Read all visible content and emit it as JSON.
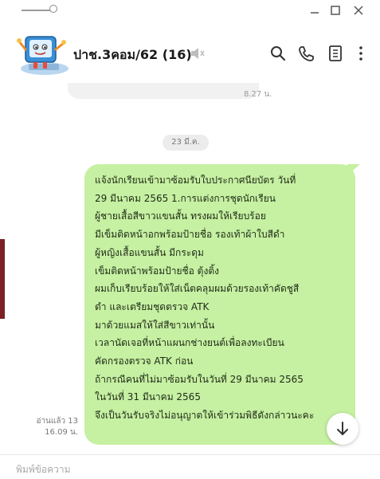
{
  "window": {
    "controls": [
      "minimize-icon",
      "maximize-icon",
      "close-icon"
    ]
  },
  "header": {
    "chat_title": "ปาช.3คอม/62 (16)",
    "icons": [
      "mute-icon",
      "search-icon",
      "phone-icon",
      "notes-icon",
      "more-icon"
    ]
  },
  "timeline": {
    "previous_message_time": "8.27 น.",
    "date_separator": "23 มี.ค.",
    "message": {
      "lines": [
        "แจ้งนักเรียนเข้ามาซ้อมรับใบประกาศนียบัตร วันที่",
        "29 มีนาคม 2565 1.การแต่งการชุดนักเรียน",
        "ผู้ชายเสื้อสีขาวแขนสั้น ทรงผมให้เรียบร้อย",
        "มีเข็มติดหน้าอกพร้อมป้ายชื่อ รองเท้าผ้าใบสีดำ",
        "ผู้หญิงเสื้อแขนสั้น มีกระดุม",
        "เข็มติดหน้าพร้อมป้ายชื่อ ตุ้งติ้ง",
        "ผมเก็บเรียบร้อยให้ใส่เน็ตคลุมผมด้วยรองเท้าคัดชูสี",
        "ดำ และเตรียมชุดตรวจ ATK",
        "มาด้วยแมสให้ใส่สีขาวเท่านั้น",
        "เวลานัดเจอที่หน้าแผนกช่างยนต์เพื่อลงทะเบียน",
        "คัดกรองตรวจ ATK ก่อน",
        "ถ้ากรณีคนที่ไม่มาซ้อมรับในวันที่ 29 มีนาคม 2565",
        "ในวันที่ 31 มีนาคม 2565",
        "จึงเป็นวันรับจริงไม่อนุญาตให้เข้าร่วมพิธีดังกล่าวนะคะ"
      ],
      "read_status": "อ่านแล้ว 13",
      "time": "16.09 น."
    }
  },
  "input": {
    "placeholder": "พิมพ์ข้อความ"
  },
  "colors": {
    "bubble_green": "#c6f0a2",
    "date_pill": "#ececec"
  }
}
